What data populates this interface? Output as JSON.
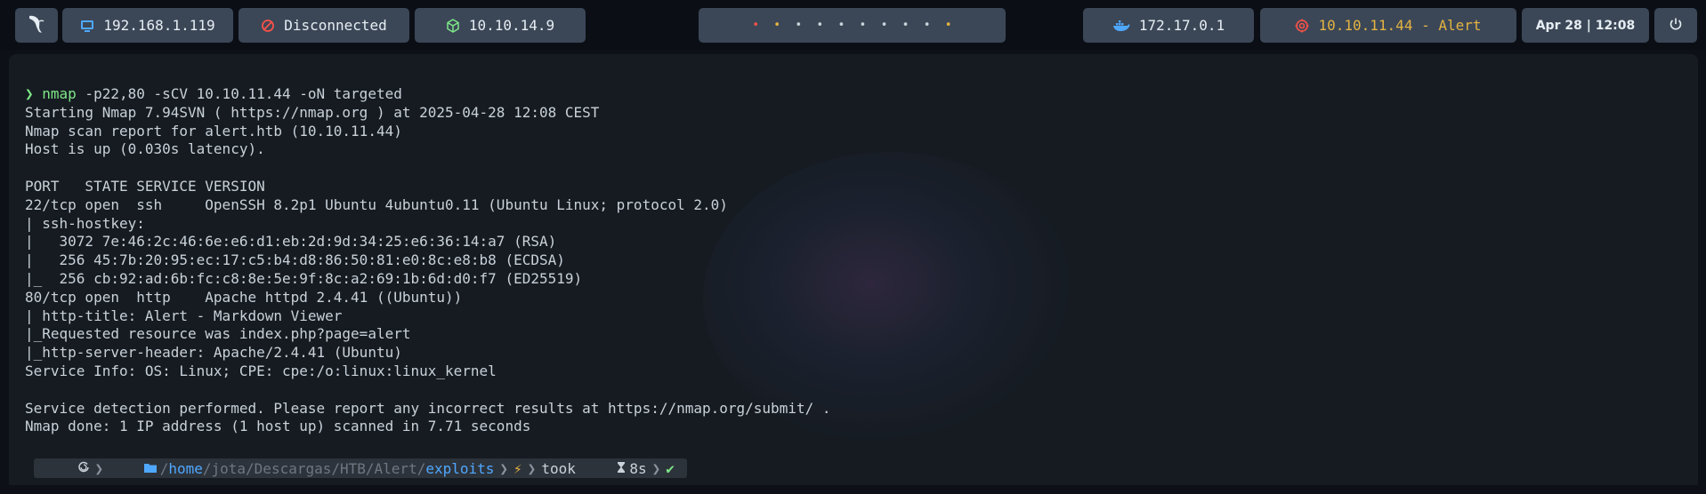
{
  "topbar": {
    "local_ip": "192.168.1.119",
    "vpn_status": "Disconnected",
    "htb_ip": "10.10.14.9",
    "docker_ip": "172.17.0.1",
    "target": "10.10.11.44 - Alert",
    "datetime": "Apr 28 | 12:08",
    "workspace_dots": [
      "•",
      "•",
      "•",
      "•",
      "•",
      "•",
      "•",
      "•",
      "•",
      "•"
    ],
    "workspace_colors": [
      "#f85149",
      "#e3b341",
      "#c9d1d9",
      "#c9d1d9",
      "#c9d1d9",
      "#c9d1d9",
      "#c9d1d9",
      "#c9d1d9",
      "#c9d1d9",
      "#e3b341"
    ],
    "icons": {
      "logo": "kali-dragon-icon",
      "ip": "monitor-icon",
      "vpn": "disconnected-icon",
      "htb": "cube-icon",
      "docker": "docker-icon",
      "target": "target-icon",
      "power": "power-icon"
    }
  },
  "terminal": {
    "command": {
      "prompt": "❯ ",
      "name": "nmap",
      "args": " -p22,80 -sCV 10.10.11.44 -oN targeted"
    },
    "output": [
      "Starting Nmap 7.94SVN ( https://nmap.org ) at 2025-04-28 12:08 CEST",
      "Nmap scan report for alert.htb (10.10.11.44)",
      "Host is up (0.030s latency).",
      "",
      "PORT   STATE SERVICE VERSION",
      "22/tcp open  ssh     OpenSSH 8.2p1 Ubuntu 4ubuntu0.11 (Ubuntu Linux; protocol 2.0)",
      "| ssh-hostkey: ",
      "|   3072 7e:46:2c:46:6e:e6:d1:eb:2d:9d:34:25:e6:36:14:a7 (RSA)",
      "|   256 45:7b:20:95:ec:17:c5:b4:d8:86:50:81:e0:8c:e8:b8 (ECDSA)",
      "|_  256 cb:92:ad:6b:fc:c8:8e:5e:9f:8c:a2:69:1b:6d:d0:f7 (ED25519)",
      "80/tcp open  http    Apache httpd 2.4.41 ((Ubuntu))",
      "| http-title: Alert - Markdown Viewer",
      "|_Requested resource was index.php?page=alert",
      "|_http-server-header: Apache/2.4.41 (Ubuntu)",
      "Service Info: OS: Linux; CPE: cpe:/o:linux:linux_kernel",
      "",
      "Service detection performed. Please report any incorrect results at https://nmap.org/submit/ .",
      "Nmap done: 1 IP address (1 host up) scanned in 7.71 seconds"
    ],
    "prompt_bar": {
      "path_prefix": "/",
      "path_home": "home",
      "path_middle": "/jota/Descargas/HTB/Alert/",
      "path_current": "exploits",
      "took_label": "took",
      "duration": "8s",
      "status": "✔",
      "bolt": "⚡"
    }
  }
}
